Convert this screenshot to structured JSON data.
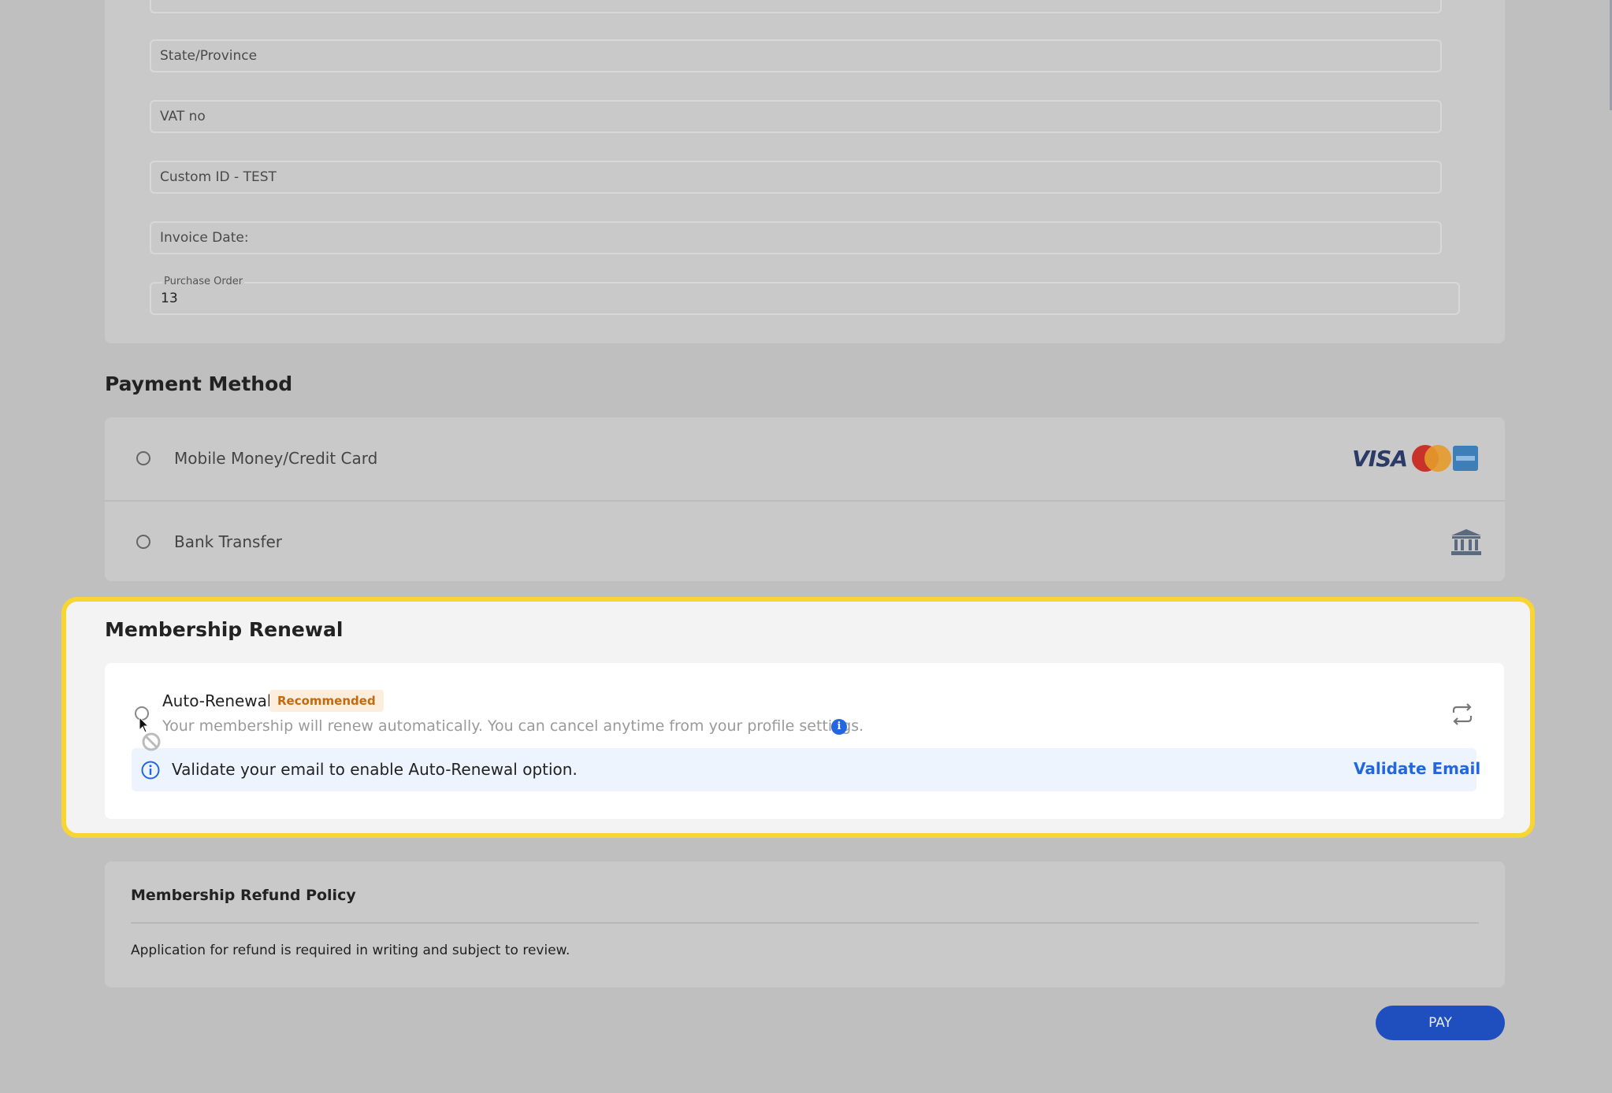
{
  "billing": {
    "fields": [
      {
        "placeholder": "State/Province"
      },
      {
        "placeholder": "VAT no"
      },
      {
        "placeholder": "Custom ID - TEST"
      },
      {
        "placeholder": "Invoice Date:"
      }
    ],
    "purchase_order": {
      "label": "Purchase Order",
      "value": "13"
    }
  },
  "payment": {
    "title": "Payment Method",
    "options": [
      {
        "label": "Mobile Money/Credit Card",
        "icon": "card-logos-icon"
      },
      {
        "label": "Bank Transfer",
        "icon": "bank-icon"
      }
    ],
    "card_logos": {
      "visa": "VISA"
    }
  },
  "renewal": {
    "title": "Membership Renewal",
    "auto_renewal_label": "Auto-Renewal",
    "badge": "Recommended",
    "description": "Your membership will renew automatically. You can cancel anytime from your profile settings.",
    "info_glyph": "i",
    "notice_text": "Validate your email to enable Auto-Renewal option.",
    "notice_link": "Validate Email"
  },
  "refund": {
    "title": "Membership Refund Policy",
    "text": "Application for refund is required in writing and subject to review."
  },
  "actions": {
    "pay_label": "PAY"
  },
  "colors": {
    "highlight": "#f8d532",
    "accent": "#2367e0",
    "pay_button": "#1f4fbf",
    "badge_text": "#c46a0e"
  }
}
